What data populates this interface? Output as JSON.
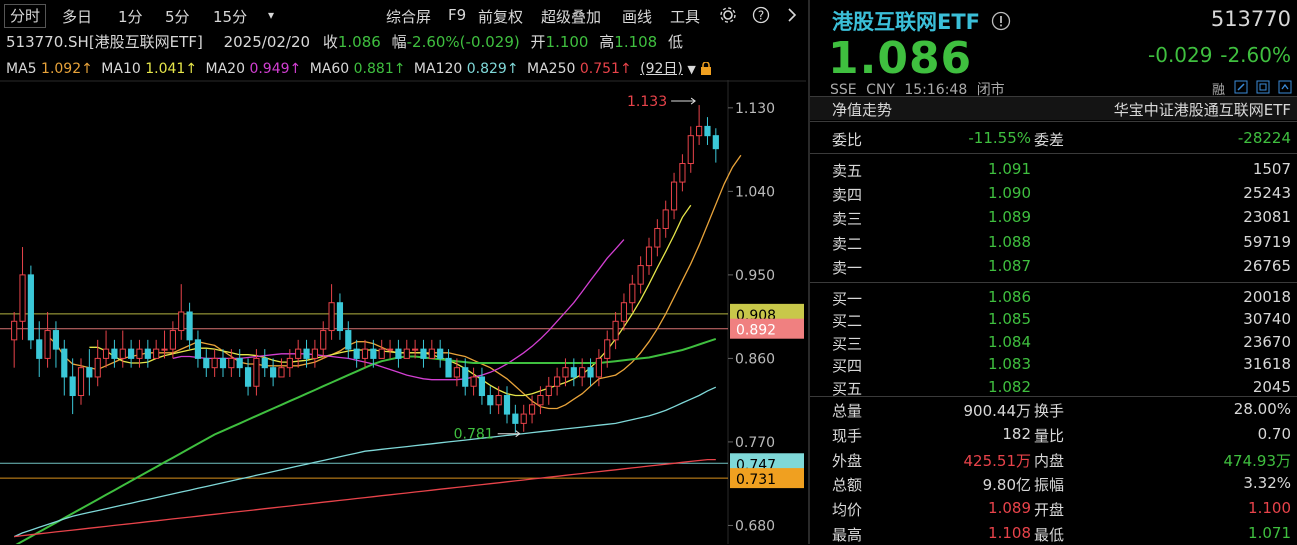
{
  "toolbar": {
    "left_items": [
      "分时",
      "多日",
      "1分",
      "5分",
      "15分"
    ],
    "dropdown_glyph": "▾",
    "right_items": [
      "综合屏",
      "F9",
      "前复权",
      "超级叠加",
      "画线",
      "工具"
    ],
    "settings_icon": "gear-icon",
    "help_icon": "question-icon",
    "collapse_icon": "chevron-right-icon"
  },
  "info": {
    "symbol": "513770.SH[港股互联网ETF]",
    "date": "2025/02/20",
    "close_label": "收",
    "close_value": "1.086",
    "change_label": "幅",
    "change_value": "-2.60%(-0.029)",
    "open_label": "开",
    "open_value": "1.100",
    "high_label": "高",
    "high_value": "1.108",
    "trailing_glyph": "低"
  },
  "ma_line": {
    "items": [
      {
        "label": "MA5",
        "value": "1.092↑",
        "color": "#e8a33a"
      },
      {
        "label": "MA10",
        "value": "1.041↑",
        "color": "#e6e64a"
      },
      {
        "label": "MA20",
        "value": "0.949↑",
        "color": "#d23fd2"
      },
      {
        "label": "MA60",
        "value": "0.881↑",
        "color": "#3fbf3f"
      },
      {
        "label": "MA120",
        "value": "0.829↑",
        "color": "#7fd8d8"
      },
      {
        "label": "MA250",
        "value": "0.751↑",
        "color": "#e8434a"
      }
    ],
    "period": "(92日)",
    "lock_icon": "lock-icon"
  },
  "chart_data": {
    "type": "candlestick",
    "ylim": [
      0.66,
      1.16
    ],
    "y_ticks": [
      "1.130",
      "1.040",
      "0.950",
      "0.860",
      "0.770",
      "0.680"
    ],
    "y_tick_values": [
      1.13,
      1.04,
      0.95,
      0.86,
      0.77,
      0.68
    ],
    "max_annotation": {
      "label": "1.133",
      "value": 1.133,
      "index": 82
    },
    "min_annotation": {
      "label": "0.781",
      "value": 0.781,
      "index": 61
    },
    "price_lines": [
      {
        "label": "0.908",
        "value": 0.908,
        "color": "#c8c84a"
      },
      {
        "label": "0.892",
        "value": 0.892,
        "color": "#f08080"
      },
      {
        "label": "0.747",
        "value": 0.747,
        "color": "#7fd8d8"
      },
      {
        "label": "0.731",
        "value": 0.731,
        "color": "#f0a020"
      }
    ],
    "candles": [
      [
        0.88,
        0.9,
        0.85,
        0.91
      ],
      [
        0.9,
        0.95,
        0.88,
        0.98
      ],
      [
        0.95,
        0.88,
        0.87,
        0.96
      ],
      [
        0.88,
        0.86,
        0.84,
        0.9
      ],
      [
        0.86,
        0.89,
        0.85,
        0.91
      ],
      [
        0.89,
        0.87,
        0.85,
        0.9
      ],
      [
        0.87,
        0.84,
        0.82,
        0.88
      ],
      [
        0.84,
        0.82,
        0.8,
        0.86
      ],
      [
        0.82,
        0.85,
        0.81,
        0.86
      ],
      [
        0.85,
        0.84,
        0.82,
        0.87
      ],
      [
        0.84,
        0.86,
        0.83,
        0.88
      ],
      [
        0.86,
        0.87,
        0.85,
        0.89
      ],
      [
        0.87,
        0.86,
        0.85,
        0.88
      ],
      [
        0.86,
        0.87,
        0.85,
        0.89
      ],
      [
        0.87,
        0.86,
        0.85,
        0.88
      ],
      [
        0.86,
        0.87,
        0.85,
        0.88
      ],
      [
        0.87,
        0.86,
        0.85,
        0.88
      ],
      [
        0.86,
        0.87,
        0.86,
        0.88
      ],
      [
        0.87,
        0.87,
        0.86,
        0.89
      ],
      [
        0.87,
        0.89,
        0.86,
        0.9
      ],
      [
        0.89,
        0.91,
        0.88,
        0.94
      ],
      [
        0.91,
        0.88,
        0.87,
        0.92
      ],
      [
        0.88,
        0.86,
        0.85,
        0.89
      ],
      [
        0.86,
        0.85,
        0.84,
        0.87
      ],
      [
        0.85,
        0.86,
        0.84,
        0.87
      ],
      [
        0.86,
        0.85,
        0.84,
        0.87
      ],
      [
        0.85,
        0.86,
        0.84,
        0.87
      ],
      [
        0.86,
        0.85,
        0.84,
        0.87
      ],
      [
        0.85,
        0.83,
        0.82,
        0.86
      ],
      [
        0.83,
        0.86,
        0.82,
        0.87
      ],
      [
        0.86,
        0.85,
        0.84,
        0.87
      ],
      [
        0.85,
        0.84,
        0.83,
        0.86
      ],
      [
        0.84,
        0.85,
        0.84,
        0.86
      ],
      [
        0.85,
        0.86,
        0.84,
        0.87
      ],
      [
        0.86,
        0.87,
        0.85,
        0.88
      ],
      [
        0.87,
        0.86,
        0.85,
        0.88
      ],
      [
        0.86,
        0.87,
        0.85,
        0.88
      ],
      [
        0.87,
        0.89,
        0.86,
        0.9
      ],
      [
        0.89,
        0.92,
        0.88,
        0.94
      ],
      [
        0.92,
        0.89,
        0.88,
        0.93
      ],
      [
        0.89,
        0.87,
        0.86,
        0.9
      ],
      [
        0.87,
        0.86,
        0.85,
        0.88
      ],
      [
        0.86,
        0.87,
        0.85,
        0.88
      ],
      [
        0.87,
        0.86,
        0.85,
        0.88
      ],
      [
        0.86,
        0.87,
        0.86,
        0.88
      ],
      [
        0.87,
        0.87,
        0.86,
        0.88
      ],
      [
        0.87,
        0.86,
        0.85,
        0.88
      ],
      [
        0.86,
        0.87,
        0.86,
        0.88
      ],
      [
        0.87,
        0.87,
        0.86,
        0.88
      ],
      [
        0.87,
        0.86,
        0.85,
        0.88
      ],
      [
        0.86,
        0.87,
        0.86,
        0.88
      ],
      [
        0.87,
        0.86,
        0.85,
        0.88
      ],
      [
        0.86,
        0.84,
        0.84,
        0.87
      ],
      [
        0.84,
        0.85,
        0.83,
        0.86
      ],
      [
        0.85,
        0.83,
        0.82,
        0.86
      ],
      [
        0.83,
        0.84,
        0.82,
        0.85
      ],
      [
        0.84,
        0.82,
        0.81,
        0.85
      ],
      [
        0.82,
        0.81,
        0.8,
        0.83
      ],
      [
        0.81,
        0.82,
        0.8,
        0.83
      ],
      [
        0.82,
        0.8,
        0.79,
        0.83
      ],
      [
        0.8,
        0.79,
        0.78,
        0.81
      ],
      [
        0.79,
        0.8,
        0.781,
        0.81
      ],
      [
        0.8,
        0.81,
        0.79,
        0.82
      ],
      [
        0.81,
        0.82,
        0.8,
        0.83
      ],
      [
        0.82,
        0.83,
        0.81,
        0.84
      ],
      [
        0.83,
        0.84,
        0.82,
        0.85
      ],
      [
        0.84,
        0.85,
        0.83,
        0.86
      ],
      [
        0.85,
        0.84,
        0.83,
        0.86
      ],
      [
        0.84,
        0.85,
        0.83,
        0.86
      ],
      [
        0.85,
        0.84,
        0.83,
        0.86
      ],
      [
        0.84,
        0.86,
        0.83,
        0.87
      ],
      [
        0.86,
        0.88,
        0.85,
        0.89
      ],
      [
        0.88,
        0.9,
        0.87,
        0.91
      ],
      [
        0.9,
        0.92,
        0.89,
        0.93
      ],
      [
        0.92,
        0.94,
        0.91,
        0.95
      ],
      [
        0.94,
        0.96,
        0.93,
        0.97
      ],
      [
        0.96,
        0.98,
        0.95,
        0.99
      ],
      [
        0.98,
        1.0,
        0.97,
        1.01
      ],
      [
        1.0,
        1.02,
        0.99,
        1.03
      ],
      [
        1.02,
        1.05,
        1.01,
        1.06
      ],
      [
        1.05,
        1.07,
        1.04,
        1.08
      ],
      [
        1.07,
        1.1,
        1.06,
        1.11
      ],
      [
        1.1,
        1.11,
        1.09,
        1.133
      ],
      [
        1.11,
        1.1,
        1.09,
        1.12
      ],
      [
        1.1,
        1.086,
        1.071,
        1.108
      ]
    ],
    "series": [
      {
        "name": "MA5",
        "color": "#e8a33a",
        "from": 4,
        "values": [
          0.884,
          0.876,
          0.862,
          0.854,
          0.852,
          0.85,
          0.848,
          0.852,
          0.856,
          0.86,
          0.862,
          0.864,
          0.866,
          0.866,
          0.866,
          0.866,
          0.87,
          0.874,
          0.878,
          0.876,
          0.874,
          0.868,
          0.862,
          0.856,
          0.854,
          0.854,
          0.852,
          0.852,
          0.852,
          0.852,
          0.852,
          0.854,
          0.856,
          0.86,
          0.864,
          0.868,
          0.874,
          0.878,
          0.878,
          0.876,
          0.872,
          0.868,
          0.866,
          0.866,
          0.866,
          0.866,
          0.866,
          0.866,
          0.866,
          0.864,
          0.862,
          0.858,
          0.854,
          0.85,
          0.844,
          0.838,
          0.83,
          0.822,
          0.814,
          0.808,
          0.806,
          0.806,
          0.81,
          0.816,
          0.822,
          0.83,
          0.838,
          0.84,
          0.842,
          0.848,
          0.856,
          0.866,
          0.878,
          0.892,
          0.908,
          0.926,
          0.944,
          0.962,
          0.982,
          1.004,
          1.026,
          1.048,
          1.066,
          1.079
        ]
      },
      {
        "name": "MA10",
        "color": "#e6e64a",
        "from": 9,
        "values": [
          0.872,
          0.872,
          0.868,
          0.862,
          0.857,
          0.855,
          0.855,
          0.856,
          0.86,
          0.863,
          0.865,
          0.867,
          0.869,
          0.871,
          0.871,
          0.87,
          0.868,
          0.866,
          0.864,
          0.864,
          0.863,
          0.861,
          0.858,
          0.856,
          0.856,
          0.857,
          0.858,
          0.86,
          0.862,
          0.864,
          0.866,
          0.868,
          0.869,
          0.869,
          0.869,
          0.868,
          0.867,
          0.866,
          0.866,
          0.866,
          0.866,
          0.864,
          0.861,
          0.858,
          0.854,
          0.849,
          0.843,
          0.837,
          0.831,
          0.826,
          0.822,
          0.82,
          0.82,
          0.822,
          0.825,
          0.828,
          0.831,
          0.834,
          0.838,
          0.843,
          0.85,
          0.859,
          0.869,
          0.881,
          0.894,
          0.908,
          0.923,
          0.94,
          0.958,
          0.975,
          0.993,
          1.012,
          1.025
        ]
      },
      {
        "name": "MA20",
        "color": "#d23fd2",
        "from": 19,
        "values": [
          0.86,
          0.862,
          0.862,
          0.861,
          0.86,
          0.86,
          0.86,
          0.86,
          0.86,
          0.861,
          0.862,
          0.863,
          0.864,
          0.865,
          0.865,
          0.865,
          0.865,
          0.864,
          0.863,
          0.862,
          0.861,
          0.86,
          0.858,
          0.856,
          0.854,
          0.851,
          0.848,
          0.845,
          0.842,
          0.84,
          0.838,
          0.837,
          0.837,
          0.837,
          0.837,
          0.838,
          0.84,
          0.842,
          0.845,
          0.849,
          0.854,
          0.86,
          0.866,
          0.873,
          0.881,
          0.89,
          0.9,
          0.91,
          0.92,
          0.932,
          0.944,
          0.956,
          0.968,
          0.978,
          0.988
        ]
      },
      {
        "name": "MA60",
        "color": "#3fbf3f",
        "from": 0,
        "values": [
          0.658,
          0.663,
          0.668,
          0.673,
          0.678,
          0.683,
          0.688,
          0.693,
          0.698,
          0.703,
          0.708,
          0.713,
          0.718,
          0.723,
          0.728,
          0.733,
          0.738,
          0.743,
          0.748,
          0.753,
          0.758,
          0.763,
          0.768,
          0.773,
          0.778,
          0.782,
          0.786,
          0.79,
          0.794,
          0.798,
          0.802,
          0.806,
          0.81,
          0.814,
          0.818,
          0.822,
          0.826,
          0.83,
          0.834,
          0.838,
          0.842,
          0.846,
          0.85,
          0.854,
          0.857,
          0.859,
          0.861,
          0.862,
          0.862,
          0.861,
          0.86,
          0.859,
          0.858,
          0.857,
          0.856,
          0.855,
          0.855,
          0.855,
          0.855,
          0.855,
          0.855,
          0.855,
          0.855,
          0.855,
          0.855,
          0.855,
          0.855,
          0.855,
          0.855,
          0.855,
          0.855,
          0.856,
          0.857,
          0.858,
          0.859,
          0.86,
          0.861,
          0.863,
          0.865,
          0.867,
          0.869,
          0.872,
          0.875,
          0.878,
          0.881
        ]
      },
      {
        "name": "MA120",
        "color": "#7fd8d8",
        "from": 0,
        "values": [
          0.668,
          0.672,
          0.675,
          0.678,
          0.681,
          0.684,
          0.687,
          0.69,
          0.692,
          0.694,
          0.696,
          0.698,
          0.7,
          0.702,
          0.704,
          0.706,
          0.708,
          0.71,
          0.712,
          0.714,
          0.716,
          0.718,
          0.72,
          0.722,
          0.724,
          0.726,
          0.728,
          0.73,
          0.732,
          0.734,
          0.736,
          0.738,
          0.74,
          0.742,
          0.744,
          0.746,
          0.748,
          0.75,
          0.752,
          0.754,
          0.756,
          0.758,
          0.76,
          0.761,
          0.762,
          0.763,
          0.764,
          0.765,
          0.766,
          0.767,
          0.768,
          0.769,
          0.77,
          0.771,
          0.772,
          0.773,
          0.774,
          0.775,
          0.776,
          0.777,
          0.778,
          0.779,
          0.78,
          0.781,
          0.782,
          0.783,
          0.784,
          0.785,
          0.786,
          0.787,
          0.788,
          0.789,
          0.79,
          0.792,
          0.794,
          0.796,
          0.798,
          0.801,
          0.804,
          0.808,
          0.812,
          0.816,
          0.82,
          0.825,
          0.829
        ]
      },
      {
        "name": "MA250",
        "color": "#e8434a",
        "from": 0,
        "values": [
          0.668,
          0.669,
          0.67,
          0.671,
          0.672,
          0.673,
          0.674,
          0.675,
          0.676,
          0.677,
          0.678,
          0.679,
          0.68,
          0.681,
          0.682,
          0.683,
          0.684,
          0.685,
          0.686,
          0.687,
          0.688,
          0.689,
          0.69,
          0.691,
          0.692,
          0.693,
          0.694,
          0.695,
          0.696,
          0.697,
          0.698,
          0.699,
          0.7,
          0.701,
          0.702,
          0.703,
          0.704,
          0.705,
          0.706,
          0.707,
          0.708,
          0.709,
          0.71,
          0.711,
          0.712,
          0.713,
          0.714,
          0.715,
          0.716,
          0.717,
          0.718,
          0.719,
          0.72,
          0.721,
          0.722,
          0.723,
          0.724,
          0.725,
          0.726,
          0.727,
          0.728,
          0.729,
          0.73,
          0.731,
          0.732,
          0.733,
          0.734,
          0.735,
          0.736,
          0.737,
          0.738,
          0.739,
          0.74,
          0.741,
          0.742,
          0.743,
          0.744,
          0.745,
          0.746,
          0.747,
          0.748,
          0.749,
          0.75,
          0.751,
          0.751
        ]
      }
    ]
  },
  "quote": {
    "name": "港股互联网ETF",
    "info_icon": "info-icon",
    "code": "513770",
    "price": "1.086",
    "change": "-0.029",
    "change_pct": "-2.60%",
    "exchange": "SSE",
    "currency": "CNY",
    "time": "15:16:48",
    "status": "闭市",
    "small_icons": [
      "融",
      "pencil-icon",
      "copy-icon",
      "share-icon"
    ],
    "nav_label": "净值走势",
    "index_name": "华宝中证港股通互联网ETF",
    "weibi_label": "委比",
    "weibi_value": "-11.55%",
    "weicha_label": "委差",
    "weicha_value": "-28224",
    "asks": [
      {
        "label": "卖五",
        "price": "1.091",
        "volume": "1507"
      },
      {
        "label": "卖四",
        "price": "1.090",
        "volume": "25243"
      },
      {
        "label": "卖三",
        "price": "1.089",
        "volume": "23081"
      },
      {
        "label": "卖二",
        "price": "1.088",
        "volume": "59719"
      },
      {
        "label": "卖一",
        "price": "1.087",
        "volume": "26765"
      }
    ],
    "bids": [
      {
        "label": "买一",
        "price": "1.086",
        "volume": "20018"
      },
      {
        "label": "买二",
        "price": "1.085",
        "volume": "30740"
      },
      {
        "label": "买三",
        "price": "1.084",
        "volume": "23670"
      },
      {
        "label": "买四",
        "price": "1.083",
        "volume": "31618"
      },
      {
        "label": "买五",
        "price": "1.082",
        "volume": "2045"
      }
    ],
    "stats": [
      {
        "l1": "总量",
        "v1": "900.44万",
        "c1": "#d8d8d8",
        "l2": "换手",
        "v2": "28.00%",
        "c2": "#d8d8d8"
      },
      {
        "l1": "现手",
        "v1": "182",
        "c1": "#d8d8d8",
        "l2": "量比",
        "v2": "0.70",
        "c2": "#d8d8d8"
      },
      {
        "l1": "外盘",
        "v1": "425.51万",
        "c1": "#e8434a",
        "l2": "内盘",
        "v2": "474.93万",
        "c2": "#3fbf3f"
      },
      {
        "l1": "总额",
        "v1": "9.80亿",
        "c1": "#d8d8d8",
        "l2": "振幅",
        "v2": "3.32%",
        "c2": "#d8d8d8"
      },
      {
        "l1": "均价",
        "v1": "1.089",
        "c1": "#e8434a",
        "l2": "开盘",
        "v2": "1.100",
        "c2": "#e8434a"
      },
      {
        "l1": "最高",
        "v1": "1.108",
        "c1": "#e8434a",
        "l2": "最低",
        "v2": "1.071",
        "c2": "#3fbf3f"
      }
    ]
  }
}
